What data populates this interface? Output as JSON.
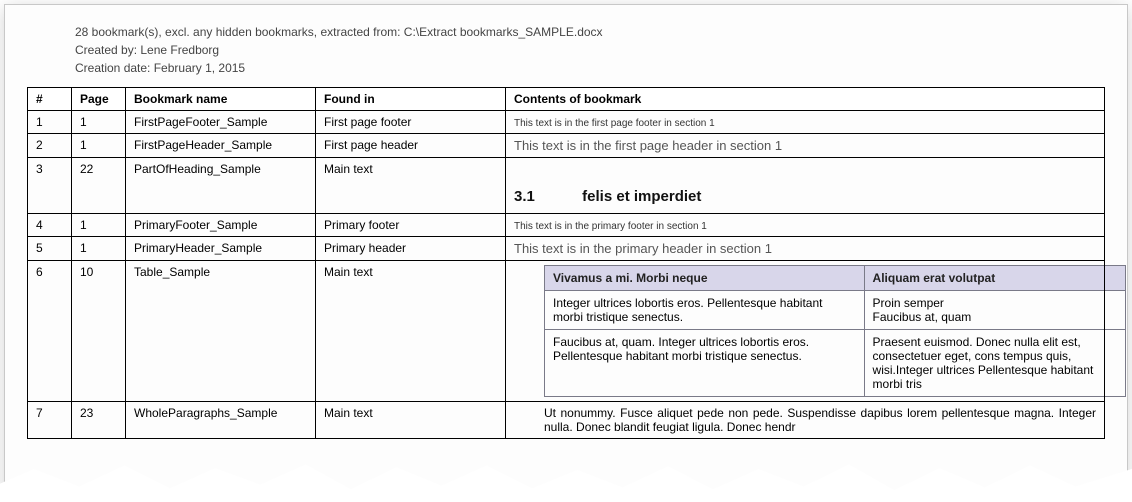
{
  "meta": {
    "line1": "28 bookmark(s), excl. any hidden bookmarks, extracted from: C:\\Extract bookmarks_SAMPLE.docx",
    "line2": "Created by: Lene Fredborg",
    "line3": "Creation date: February 1, 2015"
  },
  "headers": {
    "num": "#",
    "page": "Page",
    "name": "Bookmark  name",
    "found": "Found in",
    "contents": "Contents  of bookmark"
  },
  "rows": {
    "r1": {
      "num": "1",
      "page": "1",
      "name": "FirstPageFooter_Sample",
      "found": "First page footer",
      "contents": "This text is in the first page footer in section 1"
    },
    "r2": {
      "num": "2",
      "page": "1",
      "name": "FirstPageHeader_Sample",
      "found": "First page header",
      "contents": "This text is in the first page header in section 1"
    },
    "r3": {
      "num": "3",
      "page": "22",
      "name": "PartOfHeading_Sample",
      "found": "Main text",
      "heading_no": "3.1",
      "heading_text": "felis et imperdiet"
    },
    "r4": {
      "num": "4",
      "page": "1",
      "name": "PrimaryFooter_Sample",
      "found": "Primary footer",
      "contents": "This text is in the primary footer in section 1"
    },
    "r5": {
      "num": "5",
      "page": "1",
      "name": "PrimaryHeader_Sample",
      "found": "Primary header",
      "contents": "This text is in the primary header in section 1"
    },
    "r6": {
      "num": "6",
      "page": "10",
      "name": "Table_Sample",
      "found": "Main text",
      "inner_headers": {
        "c1": "Vivamus a mi. Morbi neque",
        "c2": "Aliquam  erat volutpat"
      },
      "inner_rows": [
        {
          "c1": "Integer ultrices lobortis eros. Pellentesque habitant morbi tristique senectus.",
          "c2": "Proin semper\nFaucibus at, quam"
        },
        {
          "c1": "Faucibus at, quam. Integer ultrices lobortis eros. Pellentesque habitant morbi tristique senectus.",
          "c2": "Praesent euismod. Donec nulla elit est, consectetuer eget, cons tempus quis, wisi.Integer ultrices Pellentesque habitant morbi tris"
        }
      ]
    },
    "r7": {
      "num": "7",
      "page": "23",
      "name": "WholeParagraphs_Sample",
      "found": "Main text",
      "contents": "Ut nonummy. Fusce aliquet pede non pede. Suspendisse dapibus lorem pellentesque magna. Integer nulla. Donec blandit feugiat ligula. Donec hendr"
    }
  }
}
